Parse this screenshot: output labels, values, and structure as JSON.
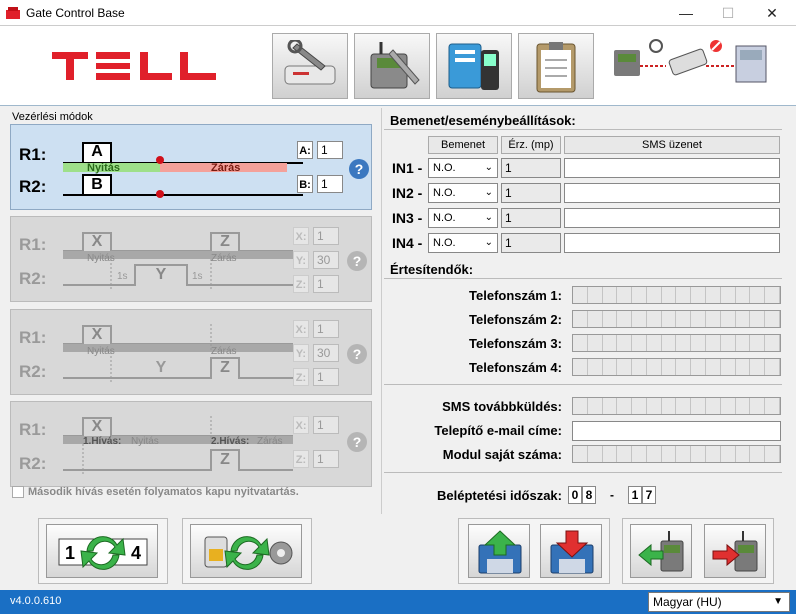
{
  "window": {
    "title": "Gate Control Base",
    "minimize": "—",
    "maximize": "☐",
    "close": "✕"
  },
  "colors": {
    "brand_red": "#e0202a",
    "status_bar": "#1a6fc4",
    "active_panel": "#cde0f2"
  },
  "toolbar": {
    "icons": [
      "settings-wrench-icon",
      "module-settings-icon",
      "phonebook-icon",
      "clipboard-icon",
      "connection-status-icon"
    ]
  },
  "left": {
    "section_title": "Vezérlési módok",
    "mode1": {
      "r1": "R1:",
      "r2": "R2:",
      "box_a": "A",
      "box_b": "B",
      "open": "Nyitás",
      "close": "Zárás",
      "a_label": "A:",
      "a_value": "1",
      "b_label": "B:",
      "b_value": "1",
      "help": "?"
    },
    "mode2": {
      "r1": "R1:",
      "r2": "R2:",
      "box_x": "X",
      "box_z": "Z",
      "box_y": "Y",
      "open": "Nyitás",
      "close": "Zárás",
      "delay1": "1s",
      "delay2": "1s",
      "x_label": "X:",
      "x_value": "1",
      "y_label": "Y:",
      "y_value": "30",
      "z_label": "Z:",
      "z_value": "1",
      "help": "?"
    },
    "mode3": {
      "r1": "R1:",
      "r2": "R2:",
      "box_x": "X",
      "box_z": "Z",
      "box_y": "Y",
      "open": "Nyitás",
      "close": "Zárás",
      "x_label": "X:",
      "x_value": "1",
      "y_label": "Y:",
      "y_value": "30",
      "z_label": "Z:",
      "z_value": "1",
      "help": "?"
    },
    "mode4": {
      "r1": "R1:",
      "r2": "R2:",
      "box_x": "X",
      "box_z": "Z",
      "call1": "1.Hívás:",
      "open": "Nyitás",
      "call2": "2.Hívás:",
      "close": "Zárás",
      "x_label": "X:",
      "x_value": "1",
      "z_label": "Z:",
      "z_value": "1",
      "help": "?"
    },
    "checkbox_label": "Második hívás esetén folyamatos kapu nyitvatartás."
  },
  "right": {
    "inputs_title": "Bemenet/eseménybeállítások:",
    "col_input": "Bemenet",
    "col_sens": "Érz. (mp)",
    "col_sms": "SMS üzenet",
    "rows": [
      {
        "label": "IN1 -",
        "mode": "N.O.",
        "sens": "1",
        "sms": ""
      },
      {
        "label": "IN2 -",
        "mode": "N.O.",
        "sens": "1",
        "sms": ""
      },
      {
        "label": "IN3 -",
        "mode": "N.O.",
        "sens": "1",
        "sms": ""
      },
      {
        "label": "IN4 -",
        "mode": "N.O.",
        "sens": "1",
        "sms": ""
      }
    ],
    "notify_title": "Értesítendők:",
    "phones": [
      "Telefonszám 1:",
      "Telefonszám 2:",
      "Telefonszám 3:",
      "Telefonszám 4:"
    ],
    "sms_forward": "SMS továbbküldés:",
    "installer_email": "Telepítő e-mail címe:",
    "module_number": "Modul saját száma:",
    "entry_period": "Beléptetési időszak:",
    "from_d1": "0",
    "from_d2": "8",
    "dash": "-",
    "to_d1": "1",
    "to_d2": "7"
  },
  "bottom": {
    "counter_digits": {
      "left": "1",
      "right": "4"
    },
    "buttons": [
      "renumber-icon",
      "sim-sync-settings-icon",
      "save-upload-icon",
      "download-icon",
      "read-from-module-icon",
      "write-to-module-icon"
    ]
  },
  "status": {
    "version": "v4.0.0.610",
    "language": "Magyar (HU)"
  }
}
